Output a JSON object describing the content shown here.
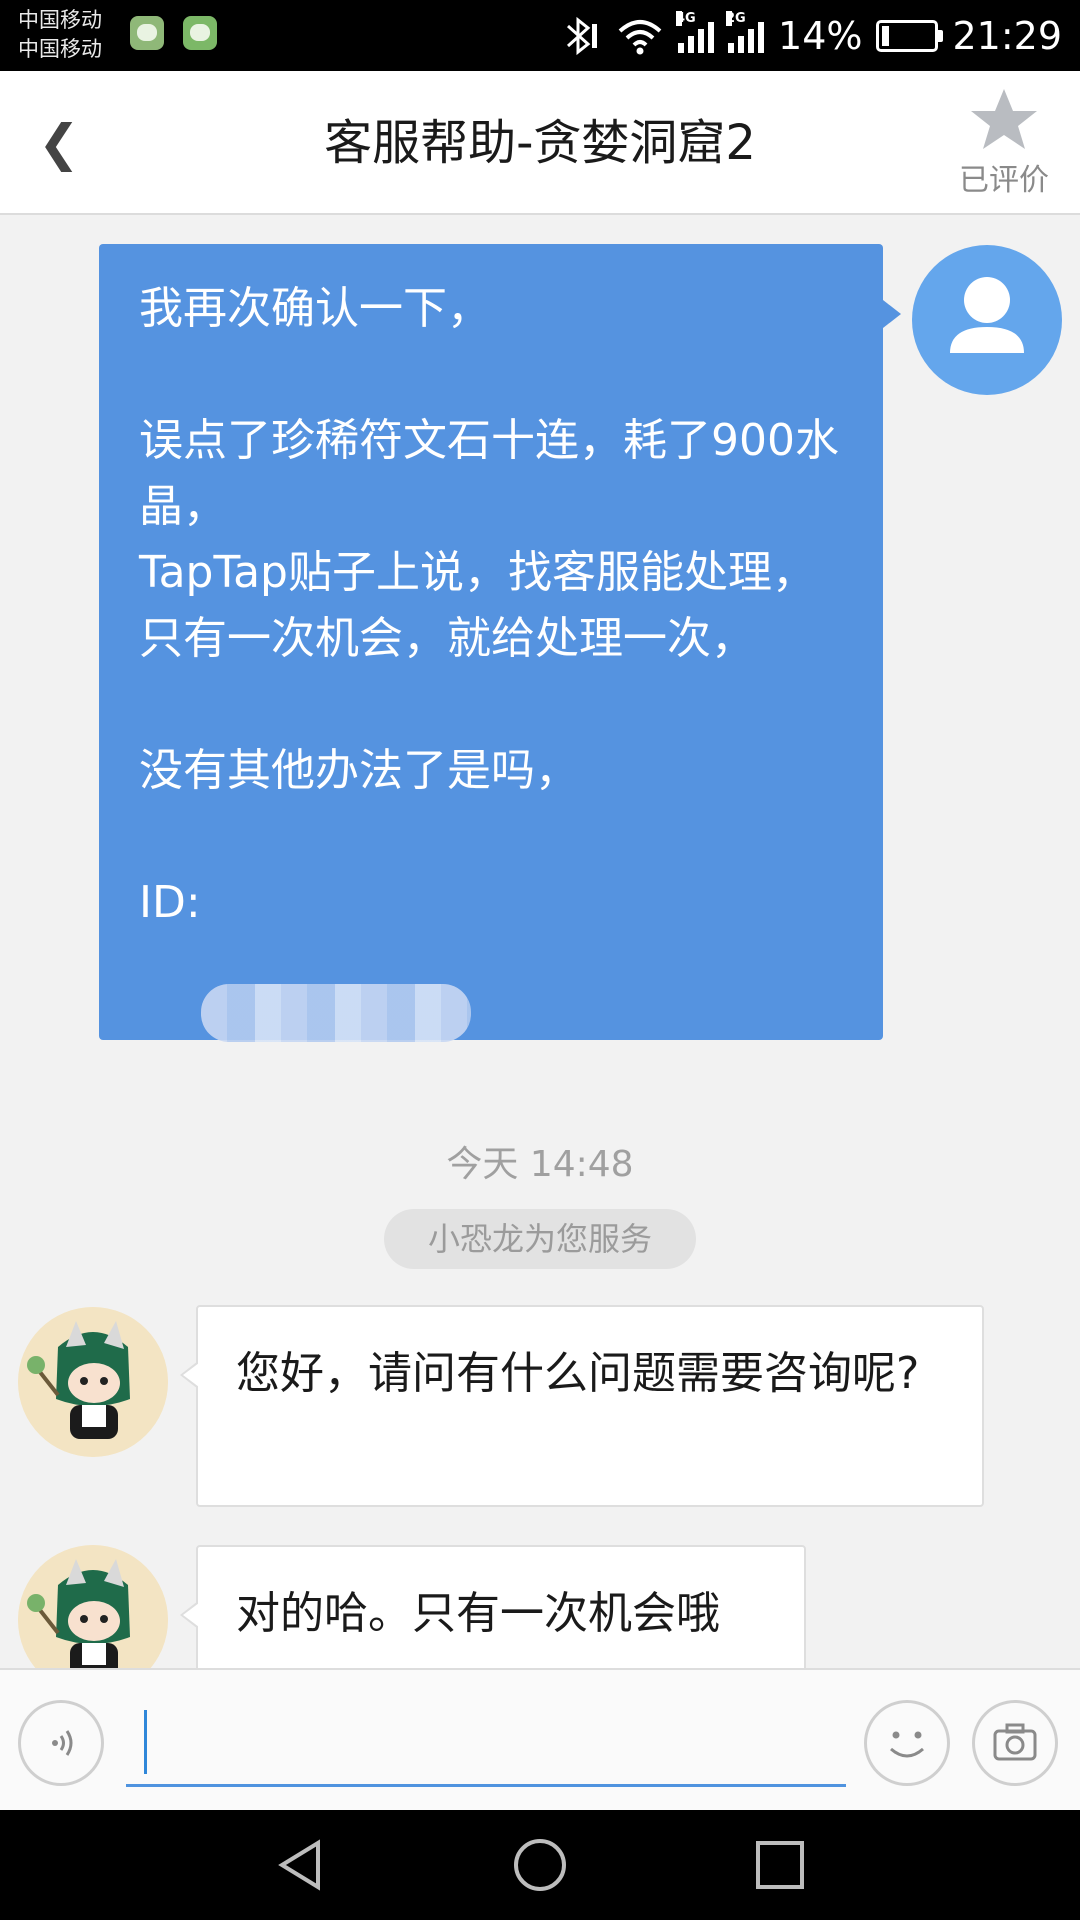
{
  "status_bar": {
    "carrier_1": "中国移动",
    "carrier_2": "中国移动",
    "network_1": "4G",
    "network_2": "2G",
    "battery_percent": "14%",
    "battery_level": 0.14,
    "time": "21:29"
  },
  "header": {
    "back_symbol": "❮",
    "title": "客服帮助-贪婪洞窟2",
    "rating_label": "已评价"
  },
  "messages": {
    "user_message": "我再次确认一下，\n\n误点了珍稀符文石十连，耗了900水晶，\nTapTap贴子上说，找客服能处理，只有一次机会，就给处理一次，\n\n没有其他办法了是吗，\n\nID:",
    "timestamp": "今天 14:48",
    "service_notice": "小恐龙为您服务",
    "agent_message_1": "您好，请问有什么问题需要咨询呢?",
    "agent_message_2": "对的哈。只有一次机会哦"
  },
  "input": {
    "value": ""
  },
  "colors": {
    "user_bubble": "#5593e0",
    "accent": "#4f93df"
  }
}
